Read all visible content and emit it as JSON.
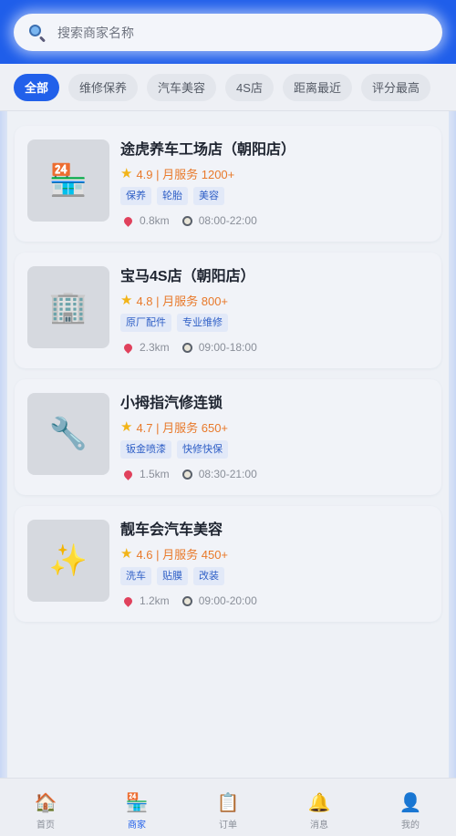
{
  "search": {
    "placeholder": "搜索商家名称",
    "icon": "search-icon"
  },
  "filters": [
    {
      "label": "全部",
      "active": true
    },
    {
      "label": "维修保养",
      "active": false
    },
    {
      "label": "汽车美容",
      "active": false
    },
    {
      "label": "4S店",
      "active": false
    },
    {
      "label": "距离最近",
      "active": false
    },
    {
      "label": "评分最高",
      "active": false
    }
  ],
  "merchants": [
    {
      "name": "途虎养车工场店（朝阳店）",
      "rating": "4.9 | 月服务 1200+",
      "tags": [
        "保养",
        "轮胎",
        "美容"
      ],
      "distance": "0.8km",
      "hours": "08:00-22:00",
      "thumb_icon": "convenience-store-icon",
      "thumb_glyph": "🏪"
    },
    {
      "name": "宝马4S店（朝阳店）",
      "rating": "4.8 | 月服务 800+",
      "tags": [
        "原厂配件",
        "专业维修"
      ],
      "distance": "2.3km",
      "hours": "09:00-18:00",
      "thumb_icon": "office-building-icon",
      "thumb_glyph": "🏢"
    },
    {
      "name": "小拇指汽修连锁",
      "rating": "4.7 | 月服务 650+",
      "tags": [
        "钣金喷漆",
        "快修快保"
      ],
      "distance": "1.5km",
      "hours": "08:30-21:00",
      "thumb_icon": "wrench-icon",
      "thumb_glyph": "🔧"
    },
    {
      "name": "靓车会汽车美容",
      "rating": "4.6 | 月服务 450+",
      "tags": [
        "洗车",
        "贴膜",
        "改装"
      ],
      "distance": "1.2km",
      "hours": "09:00-20:00",
      "thumb_icon": "sparkles-icon",
      "thumb_glyph": "✨"
    }
  ],
  "tabbar": [
    {
      "label": "首页",
      "icon": "home-icon",
      "glyph": "🏠",
      "active": false
    },
    {
      "label": "商家",
      "icon": "store-icon",
      "glyph": "🏪",
      "active": true
    },
    {
      "label": "订单",
      "icon": "clipboard-icon",
      "glyph": "📋",
      "active": false
    },
    {
      "label": "消息",
      "icon": "bell-icon",
      "glyph": "🔔",
      "active": false
    },
    {
      "label": "我的",
      "icon": "user-icon",
      "glyph": "👤",
      "active": false
    }
  ],
  "colors": {
    "primary": "#2160ea",
    "rating": "#e8792a",
    "tag_text": "#2f5fc6",
    "tag_bg": "#e2e9f8"
  }
}
